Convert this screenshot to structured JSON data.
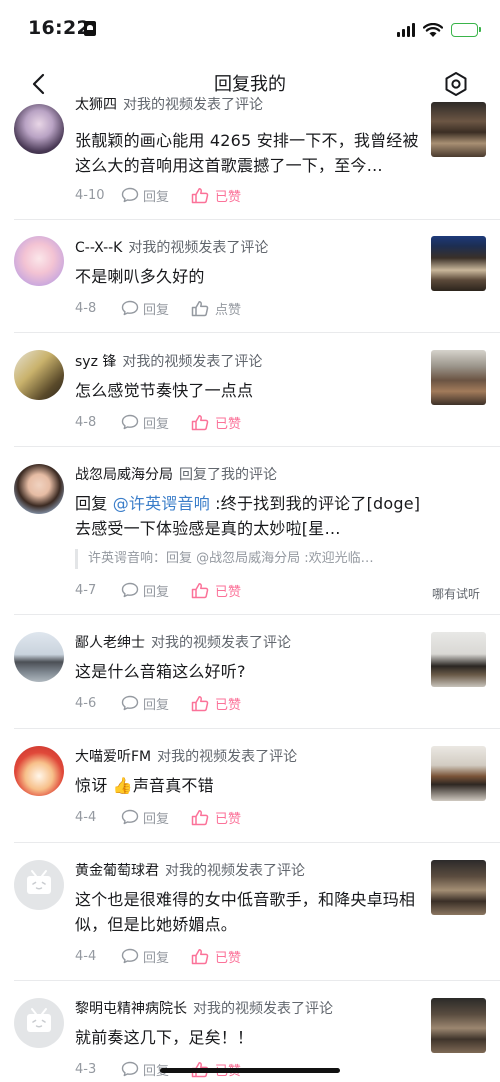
{
  "status_bar": {
    "time": "16:22"
  },
  "header": {
    "title": "回复我的"
  },
  "items": [
    {
      "user": "太狮四",
      "action": "对我的视频发表了评论",
      "text": "张靓颖的画心能用 4265 安排一下不，我曾经被这么大的音响用这首歌震撼了一下，至今…",
      "date": "4-10",
      "reply_label": "回复",
      "like_label": "已赞",
      "liked": true
    },
    {
      "user": "C--X--K",
      "action": "对我的视频发表了评论",
      "text": "不是喇叭多久好的",
      "date": "4-8",
      "reply_label": "回复",
      "like_label": "点赞",
      "liked": false
    },
    {
      "user": "syz 锋",
      "action": "对我的视频发表了评论",
      "text": "怎么感觉节奏快了一点点",
      "date": "4-8",
      "reply_label": "回复",
      "like_label": "已赞",
      "liked": true
    },
    {
      "user": "战忽局威海分局",
      "action": "回复了我的评论",
      "text_prefix": "回复 ",
      "mention": "@许英谔音响",
      "text_rest": " :终于找到我的评论了[doge]去感受一下体验感是真的太妙啦[星…",
      "quote": "许英谔音响：回复 @战忽局威海分局 :欢迎光临…",
      "side_text": "哪有试听",
      "date": "4-7",
      "reply_label": "回复",
      "like_label": "已赞",
      "liked": true
    },
    {
      "user": "鄙人老绅士",
      "action": "对我的视频发表了评论",
      "text": "这是什么音箱这么好听?",
      "date": "4-6",
      "reply_label": "回复",
      "like_label": "已赞",
      "liked": true
    },
    {
      "user": "大喵爱听FM",
      "action": "对我的视频发表了评论",
      "text_a": "惊讶 ",
      "emoji": "👍",
      "text_b": "声音真不错",
      "date": "4-4",
      "reply_label": "回复",
      "like_label": "已赞",
      "liked": true
    },
    {
      "user": "黄金葡萄球君",
      "action": "对我的视频发表了评论",
      "text": "这个也是很难得的女中低音歌手，和降央卓玛相似，但是比她娇媚点。",
      "date": "4-4",
      "reply_label": "回复",
      "like_label": "已赞",
      "liked": true
    },
    {
      "user": "黎明屯精神病院长",
      "action": "对我的视频发表了评论",
      "text": "就前奏这几下，足矣！！",
      "date": "4-3",
      "reply_label": "回复",
      "like_label": "已赞",
      "liked": true
    }
  ],
  "colors": {
    "liked": "#fb7299",
    "meta": "#9499a0",
    "mention": "#3a7dc9"
  }
}
